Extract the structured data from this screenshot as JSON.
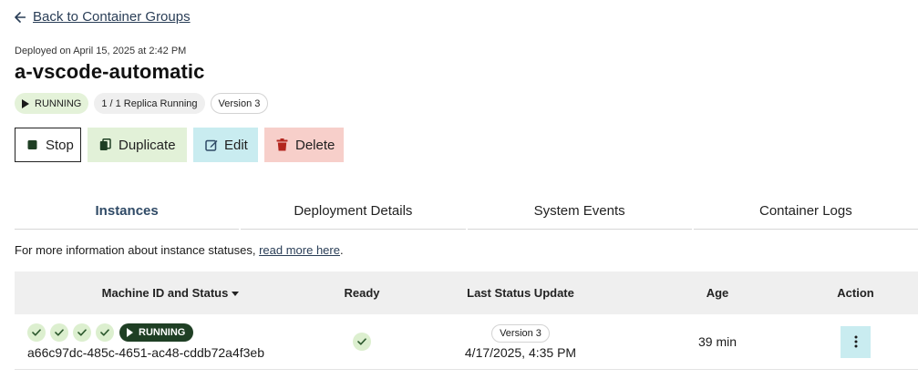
{
  "nav": {
    "back_label": "Back to Container Groups"
  },
  "header": {
    "deployed": "Deployed on April 15, 2025 at 2:42 PM",
    "title": "a-vscode-automatic",
    "badges": {
      "status": "RUNNING",
      "replicas": "1 / 1 Replica Running",
      "version": "Version 3"
    }
  },
  "actions": {
    "stop": "Stop",
    "duplicate": "Duplicate",
    "edit": "Edit",
    "delete": "Delete"
  },
  "tabs": [
    {
      "label": "Instances",
      "active": true
    },
    {
      "label": "Deployment Details"
    },
    {
      "label": "System Events"
    },
    {
      "label": "Container Logs"
    }
  ],
  "info": {
    "text": "For more information about instance statuses, ",
    "link": "read more here",
    "suffix": "."
  },
  "table": {
    "columns": [
      "Machine ID and Status",
      "Ready",
      "Last Status Update",
      "Age",
      "Action"
    ],
    "rows": [
      {
        "status": "RUNNING",
        "machine_id": "a66c97dc-485c-4651-ac48-cddb72a4f3eb",
        "version": "Version 3",
        "last_update": "4/17/2025, 4:35 PM",
        "age": "39 min"
      }
    ]
  },
  "colors": {
    "link": "#2a3e57",
    "running_bg": "#e4f2d9",
    "running_pill": "#1f3f24",
    "duplicate_bg": "#e2f1d8",
    "edit_bg": "#c9ecf0",
    "delete_bg": "#f7cfca",
    "header_bg": "#efefef"
  },
  "icons": {
    "back": "arrow-left-icon",
    "stop": "stop-square-icon",
    "duplicate": "copy-icon",
    "edit": "edit-pencil-icon",
    "delete": "trash-icon",
    "check": "check-icon",
    "play": "play-icon",
    "action": "kebab-menu-icon"
  }
}
